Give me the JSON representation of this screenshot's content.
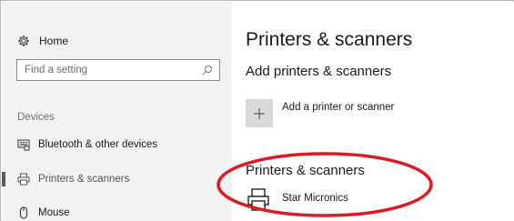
{
  "sidebar": {
    "home_label": "Home",
    "search_placeholder": "Find a setting",
    "section_label": "Devices",
    "items": [
      {
        "label": "Bluetooth & other devices",
        "icon": "bluetooth-devices-icon"
      },
      {
        "label": "Printers & scanners",
        "icon": "printer-icon",
        "selected": true
      },
      {
        "label": "Mouse",
        "icon": "mouse-icon"
      }
    ]
  },
  "main": {
    "title": "Printers & scanners",
    "add_section_title": "Add printers & scanners",
    "add_button_label": "Add a printer or scanner",
    "printers_section_title": "Printers & scanners",
    "printers": [
      {
        "name": "Star Micronics",
        "icon": "printer-icon"
      }
    ]
  },
  "annotation": {
    "shape": "ellipse",
    "color": "#d81e25"
  }
}
